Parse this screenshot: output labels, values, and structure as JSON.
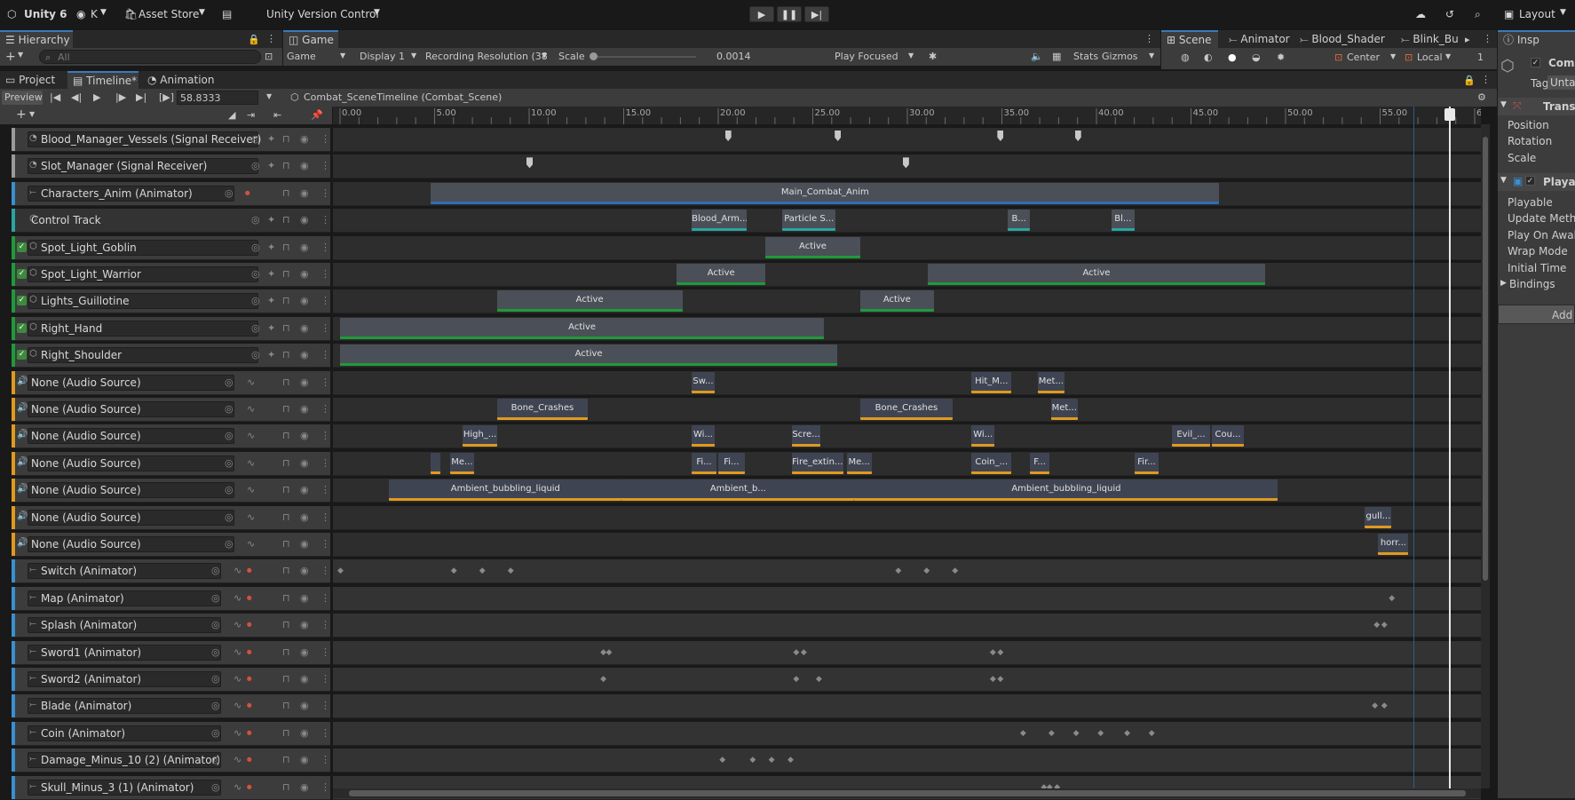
{
  "topbar": {
    "app": "Unity 6",
    "account": "K",
    "asset_store": "Asset Store",
    "version_control": "Unity Version Control",
    "layout": "Layout"
  },
  "hierarchy": {
    "tab": "Hierarchy",
    "search_placeholder": "All"
  },
  "game": {
    "tab": "Game",
    "display_mode": "Game",
    "display": "Display 1",
    "resolution": "Recording Resolution (38",
    "scale_label": "Scale",
    "scale_value": "0.0014",
    "play_focused": "Play Focused",
    "stats": "Stats",
    "gizmos": "Gizmos"
  },
  "scene_tabs": [
    "Scene",
    "Animator",
    "Blood_Shader",
    "Blink_Bu"
  ],
  "scene_toolbar": {
    "center": "Center",
    "local": "Local",
    "num": "1"
  },
  "inspector": {
    "tab": "Insp",
    "object_name": "Comb",
    "tag_label": "Tag",
    "tag_value": "Unta",
    "transform_header": "Transf",
    "position": "Position",
    "rotation": "Rotation",
    "scale": "Scale",
    "playable_header": "Playab",
    "fields": [
      "Playable",
      "Update Metho",
      "Play On Awak",
      "Wrap Mode",
      "Initial Time",
      "Bindings"
    ],
    "add_button": "Add C"
  },
  "bottom_tabs": [
    "Project",
    "Timeline*",
    "Animation"
  ],
  "timeline": {
    "preview": "Preview",
    "time": "58.8333",
    "breadcrumb": "Combat_SceneTimeline (Combat_Scene)",
    "ruler_ticks": [
      "0.00",
      "5.00",
      "10.00",
      "15.00",
      "20.00",
      "25.00",
      "30.00",
      "35.00",
      "40.00",
      "45.00",
      "50.00",
      "55.00",
      "6"
    ]
  },
  "tracks": [
    {
      "name": "Blood_Manager_Vessels (Signal Receiver)",
      "color": "#9a9a9a",
      "kind": "signal"
    },
    {
      "name": "Slot_Manager (Signal Receiver)",
      "color": "#9a9a9a",
      "kind": "signal"
    },
    {
      "name": "Characters_Anim (Animator)",
      "color": "#3a8fd0",
      "kind": "animator"
    },
    {
      "name": "Control Track",
      "color": "#2aa5a0",
      "kind": "control"
    },
    {
      "name": "Spot_Light_Goblin",
      "color": "#1f9a3a",
      "kind": "activation"
    },
    {
      "name": "Spot_Light_Warrior",
      "color": "#1f9a3a",
      "kind": "activation"
    },
    {
      "name": "Lights_Guillotine",
      "color": "#1f9a3a",
      "kind": "activation"
    },
    {
      "name": "Right_Hand",
      "color": "#1f9a3a",
      "kind": "activation"
    },
    {
      "name": "Right_Shoulder",
      "color": "#1f9a3a",
      "kind": "activation"
    },
    {
      "name": "None (Audio Source)",
      "color": "#e09a1e",
      "kind": "audio"
    },
    {
      "name": "None (Audio Source)",
      "color": "#e09a1e",
      "kind": "audio"
    },
    {
      "name": "None (Audio Source)",
      "color": "#e09a1e",
      "kind": "audio"
    },
    {
      "name": "None (Audio Source)",
      "color": "#e09a1e",
      "kind": "audio"
    },
    {
      "name": "None (Audio Source)",
      "color": "#e09a1e",
      "kind": "audio"
    },
    {
      "name": "None (Audio Source)",
      "color": "#e09a1e",
      "kind": "audio"
    },
    {
      "name": "None (Audio Source)",
      "color": "#e09a1e",
      "kind": "audio"
    },
    {
      "name": "Switch (Animator)",
      "color": "#3a8fd0",
      "kind": "animator"
    },
    {
      "name": "Map (Animator)",
      "color": "#3a8fd0",
      "kind": "animator"
    },
    {
      "name": "Splash (Animator)",
      "color": "#3a8fd0",
      "kind": "animator"
    },
    {
      "name": "Sword1 (Animator)",
      "color": "#3a8fd0",
      "kind": "animator"
    },
    {
      "name": "Sword2 (Animator)",
      "color": "#3a8fd0",
      "kind": "animator"
    },
    {
      "name": "Blade (Animator)",
      "color": "#3a8fd0",
      "kind": "animator"
    },
    {
      "name": "Coin (Animator)",
      "color": "#3a8fd0",
      "kind": "animator"
    },
    {
      "name": "Damage_Minus_10 (2) (Animator)",
      "color": "#3a8fd0",
      "kind": "animator"
    },
    {
      "name": "Skull_Minus_3 (1) (Animator)",
      "color": "#3a8fd0",
      "kind": "animator"
    }
  ],
  "clips": {
    "main_anim": "Main_Combat_Anim",
    "active": "Active",
    "control": [
      "Blood_Arm...",
      "Particle S...",
      "B...",
      "Bl..."
    ],
    "audio_row1": [
      "Sw...",
      "Hit_M...",
      "Met..."
    ],
    "audio_row2": [
      "Bone_Crashes",
      "Bone_Crashes",
      "Met..."
    ],
    "audio_row3": [
      "High_...",
      "Wi...",
      "Scre...",
      "Wi...",
      "Evil_...",
      "Cou..."
    ],
    "audio_row4": [
      "Me...",
      "Fi...",
      "Fi...",
      "Fire_extin...",
      "Me...",
      "Coin_...",
      "F...",
      "Fir..."
    ],
    "audio_row5": [
      "Ambient_bubbling_liquid",
      "Ambient_b...",
      "Ambient_bubbling_liquid"
    ],
    "audio_row6": [
      "gull..."
    ],
    "audio_row7": [
      "horr..."
    ]
  }
}
